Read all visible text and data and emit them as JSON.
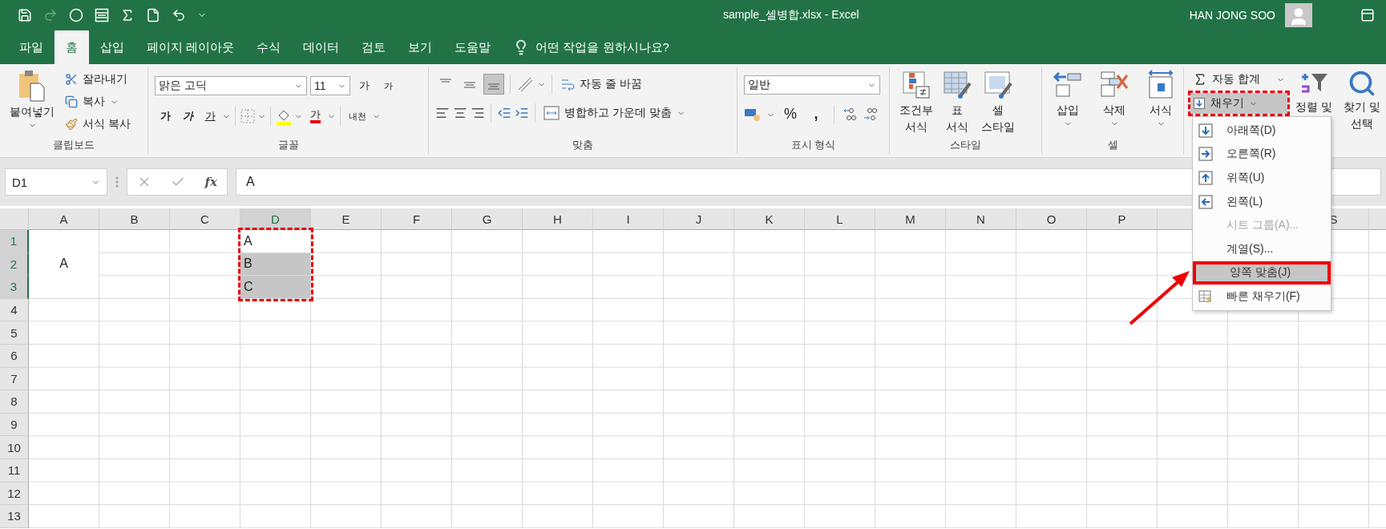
{
  "window": {
    "title": "sample_셀병합.xlsx  -  Excel",
    "user": "HAN JONG SOO"
  },
  "tabs": [
    {
      "label": "파일",
      "selected": false
    },
    {
      "label": "홈",
      "selected": true
    },
    {
      "label": "삽입",
      "selected": false
    },
    {
      "label": "페이지 레이아웃",
      "selected": false
    },
    {
      "label": "수식",
      "selected": false
    },
    {
      "label": "데이터",
      "selected": false
    },
    {
      "label": "검토",
      "selected": false
    },
    {
      "label": "보기",
      "selected": false
    },
    {
      "label": "도움말",
      "selected": false
    }
  ],
  "tell_me": "어떤 작업을 원하시나요?",
  "clipboard": {
    "label": "클립보드",
    "paste": "붙여넣기",
    "cut": "잘라내기",
    "copy": "복사",
    "format_painter": "서식 복사"
  },
  "font": {
    "label": "글꼴",
    "name": "맑은 고딕",
    "size": "11",
    "grow": "가",
    "shrink": "가",
    "bold": "가",
    "italic": "가",
    "underline": "가",
    "font_color": "가",
    "phonetic": "내천"
  },
  "alignment": {
    "label": "맞춤",
    "wrap_text": "자동 줄 바꿈",
    "merge": "병합하고 가운데 맞춤",
    "bottom_align_selected": true
  },
  "number": {
    "label": "표시 형식",
    "format": "일반",
    "percent": "%",
    "comma": ","
  },
  "styles": {
    "label": "스타일",
    "buttons": [
      {
        "lines": [
          "조건부",
          "서식"
        ]
      },
      {
        "lines": [
          "표",
          "서식"
        ]
      },
      {
        "lines": [
          "셀",
          "스타일"
        ]
      }
    ]
  },
  "cells": {
    "label": "셀",
    "buttons": [
      {
        "lines": [
          "삽입"
        ]
      },
      {
        "lines": [
          "삭제"
        ]
      },
      {
        "lines": [
          "서식"
        ]
      }
    ]
  },
  "editing": {
    "autosum": "자동 합계",
    "fill": {
      "label": "채우기",
      "highlighted": true
    },
    "sort": [
      "정렬 및"
    ],
    "find": [
      "찾기 및",
      "선택"
    ]
  },
  "fill_menu": [
    {
      "kind": "down",
      "label": "아래쪽(D)",
      "disabled": false,
      "selected": false
    },
    {
      "kind": "right",
      "label": "오른쪽(R)",
      "disabled": false,
      "selected": false
    },
    {
      "kind": "up",
      "label": "위쪽(U)",
      "disabled": false,
      "selected": false
    },
    {
      "kind": "left",
      "label": "왼쪽(L)",
      "disabled": false,
      "selected": false
    },
    {
      "kind": "plain",
      "label": "시트 그룹(A)...",
      "disabled": true,
      "selected": false
    },
    {
      "kind": "plain",
      "label": "계열(S)...",
      "disabled": false,
      "selected": false
    },
    {
      "kind": "plain",
      "label": "양쪽 맞춤(J)",
      "disabled": false,
      "selected": true
    },
    {
      "kind": "flash",
      "label": "빠른 채우기(F)",
      "disabled": false,
      "selected": false
    }
  ],
  "formula_bar": {
    "name_box": "D1",
    "fx": "fx",
    "value": "A"
  },
  "grid": {
    "columns": [
      {
        "label": "A",
        "selected": false
      },
      {
        "label": "B",
        "selected": false
      },
      {
        "label": "C",
        "selected": false
      },
      {
        "label": "D",
        "selected": true
      },
      {
        "label": "E",
        "selected": false
      },
      {
        "label": "F",
        "selected": false
      },
      {
        "label": "G",
        "selected": false
      },
      {
        "label": "H",
        "selected": false
      },
      {
        "label": "I",
        "selected": false
      },
      {
        "label": "J",
        "selected": false
      },
      {
        "label": "K",
        "selected": false
      },
      {
        "label": "L",
        "selected": false
      },
      {
        "label": "M",
        "selected": false
      },
      {
        "label": "N",
        "selected": false
      },
      {
        "label": "O",
        "selected": false
      },
      {
        "label": "P",
        "selected": false
      }
    ],
    "columns_after_menu": [
      {
        "label": "S",
        "selected": false
      }
    ],
    "merged_cell": {
      "text": "A"
    },
    "rows": [
      {
        "header": "1",
        "selected": true,
        "cells": [
          {
            "kind": "empty"
          },
          {
            "kind": "empty"
          },
          {
            "kind": "text",
            "text": "A",
            "selected": false
          }
        ]
      },
      {
        "header": "2",
        "selected": true,
        "cells": [
          {
            "kind": "empty"
          },
          {
            "kind": "empty"
          },
          {
            "kind": "text",
            "text": "B",
            "selected": true
          }
        ]
      },
      {
        "header": "3",
        "selected": true,
        "cells": [
          {
            "kind": "empty"
          },
          {
            "kind": "empty"
          },
          {
            "kind": "text",
            "text": "C",
            "selected": true
          }
        ]
      },
      {
        "header": "4",
        "selected": false
      },
      {
        "header": "5",
        "selected": false
      },
      {
        "header": "6",
        "selected": false
      },
      {
        "header": "7",
        "selected": false
      },
      {
        "header": "8",
        "selected": false
      },
      {
        "header": "9",
        "selected": false
      },
      {
        "header": "10",
        "selected": false
      },
      {
        "header": "11",
        "selected": false
      },
      {
        "header": "12",
        "selected": false
      },
      {
        "header": "13",
        "selected": false
      }
    ]
  }
}
